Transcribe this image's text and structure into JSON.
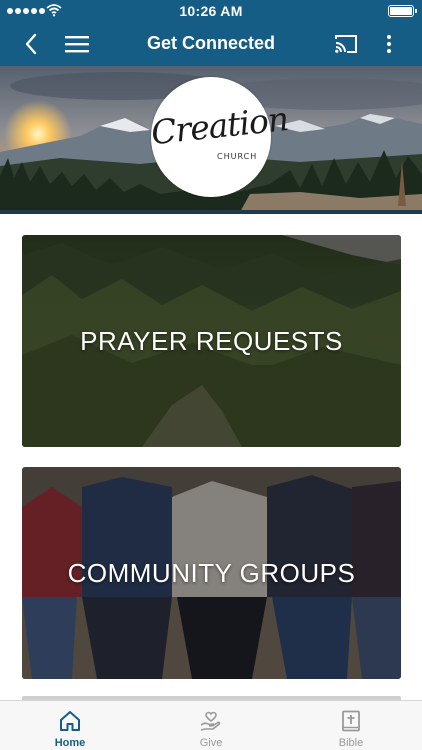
{
  "status_bar": {
    "time": "10:26 AM",
    "signal_icon": "signal-dots-icon",
    "wifi_icon": "wifi-icon",
    "battery_icon": "battery-icon"
  },
  "nav_bar": {
    "title": "Get Connected",
    "back_icon": "chevron-left-icon",
    "menu_icon": "hamburger-icon",
    "cast_icon": "cast-icon",
    "more_icon": "more-vertical-icon"
  },
  "banner": {
    "logo_text": "Creation",
    "logo_subtext": "CHURCH"
  },
  "cards": [
    {
      "label": "PRAYER REQUESTS"
    },
    {
      "label": "COMMUNITY GROUPS"
    }
  ],
  "tab_bar": {
    "active": "Home",
    "tabs": [
      {
        "label": "Home",
        "icon": "home-icon"
      },
      {
        "label": "Give",
        "icon": "give-hand-heart-icon"
      },
      {
        "label": "Bible",
        "icon": "bible-cross-icon"
      }
    ]
  },
  "colors": {
    "primary": "#155d84",
    "active_tab": "#155d84",
    "inactive_tab": "#9a9a9a"
  }
}
